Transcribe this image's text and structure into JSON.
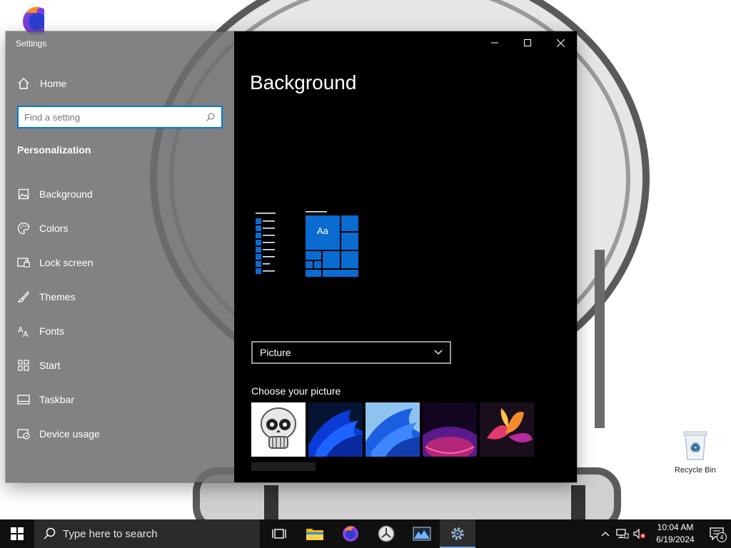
{
  "window": {
    "app_title": "Settings",
    "home_label": "Home",
    "search_placeholder": "Find a setting",
    "section_title": "Personalization",
    "nav_items": [
      {
        "label": "Background",
        "icon": "picture-icon"
      },
      {
        "label": "Colors",
        "icon": "palette-icon"
      },
      {
        "label": "Lock screen",
        "icon": "lock-screen-icon"
      },
      {
        "label": "Themes",
        "icon": "brush-icon"
      },
      {
        "label": "Fonts",
        "icon": "fonts-icon"
      },
      {
        "label": "Start",
        "icon": "start-grid-icon"
      },
      {
        "label": "Taskbar",
        "icon": "taskbar-icon"
      },
      {
        "label": "Device usage",
        "icon": "device-usage-icon"
      }
    ]
  },
  "content": {
    "page_title": "Background",
    "preview_tile_text": "Aa",
    "background_dropdown": {
      "selected": "Picture"
    },
    "choose_picture_label": "Choose your picture"
  },
  "desktop": {
    "recycle_bin_label": "Recycle Bin"
  },
  "taskbar": {
    "search_placeholder": "Type here to search",
    "time": "10:04 AM",
    "date": "6/19/2024",
    "notification_count": "4",
    "accent_color": "#0078d7"
  }
}
